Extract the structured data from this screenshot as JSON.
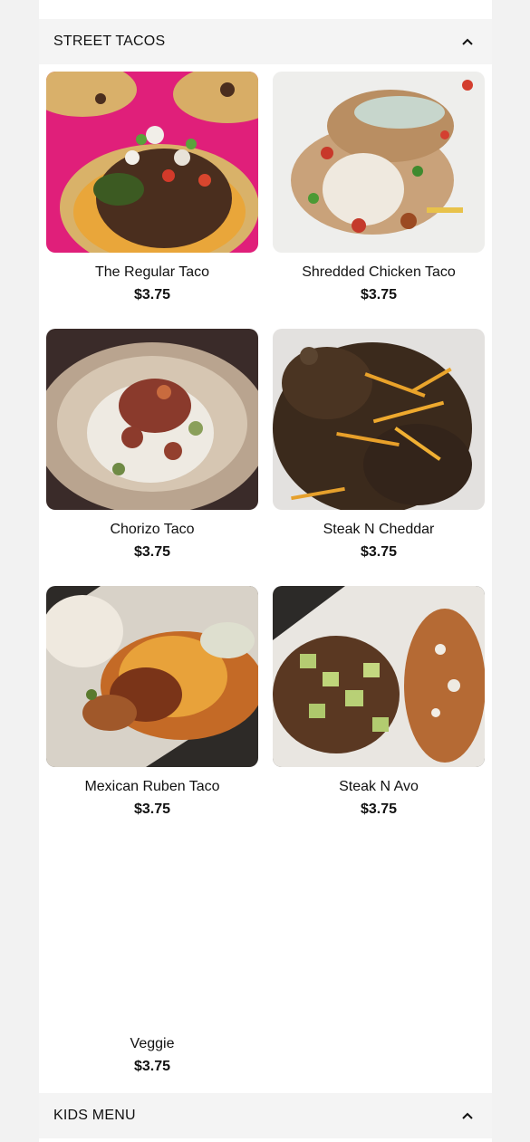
{
  "sections": [
    {
      "title": "STREET TACOS",
      "expanded": true
    },
    {
      "title": "KIDS MENU",
      "expanded": true
    }
  ],
  "items": [
    {
      "name": "The Regular Taco",
      "price": "$3.75",
      "has_image": true
    },
    {
      "name": "Shredded Chicken Taco",
      "price": "$3.75",
      "has_image": true
    },
    {
      "name": "Chorizo Taco",
      "price": "$3.75",
      "has_image": true
    },
    {
      "name": "Steak N Cheddar",
      "price": "$3.75",
      "has_image": true
    },
    {
      "name": "Mexican Ruben Taco",
      "price": "$3.75",
      "has_image": true
    },
    {
      "name": "Steak N Avo",
      "price": "$3.75",
      "has_image": true
    },
    {
      "name": "Veggie",
      "price": "$3.75",
      "has_image": false
    }
  ],
  "icons": {
    "collapse": "chevron-up-icon"
  }
}
